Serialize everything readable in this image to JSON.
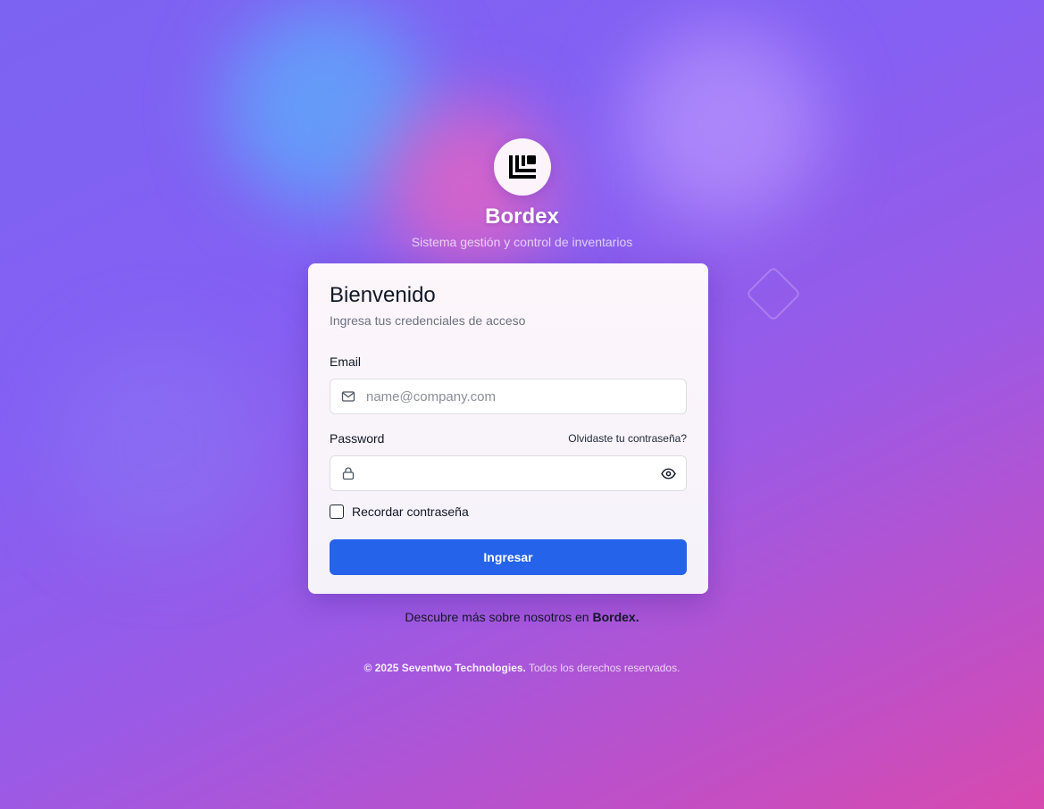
{
  "brand": {
    "name": "Bordex",
    "subtitle": "Sistema gestión y control de inventarios",
    "logo_icon": "bordex-logo-icon"
  },
  "login": {
    "title": "Bienvenido",
    "subtitle": "Ingresa tus credenciales de acceso",
    "email_label": "Email",
    "email_placeholder": "name@company.com",
    "email_icon": "mail-icon",
    "password_label": "Password",
    "forgot_link": "Olvidaste tu contraseña?",
    "password_icon": "lock-icon",
    "password_toggle_icon": "eye-icon",
    "remember_label": "Recordar contraseña",
    "submit_label": "Ingresar"
  },
  "discover": {
    "text": "Descubre más sobre nosotros en ",
    "link": "Bordex."
  },
  "footer": {
    "copyright": "© 2025 Seventwo Technologies.",
    "rights": " Todos los derechos reservados."
  },
  "colors": {
    "primary_button": "#2563eb",
    "background_start": "#7c63f2",
    "background_end": "#d74aaf"
  }
}
